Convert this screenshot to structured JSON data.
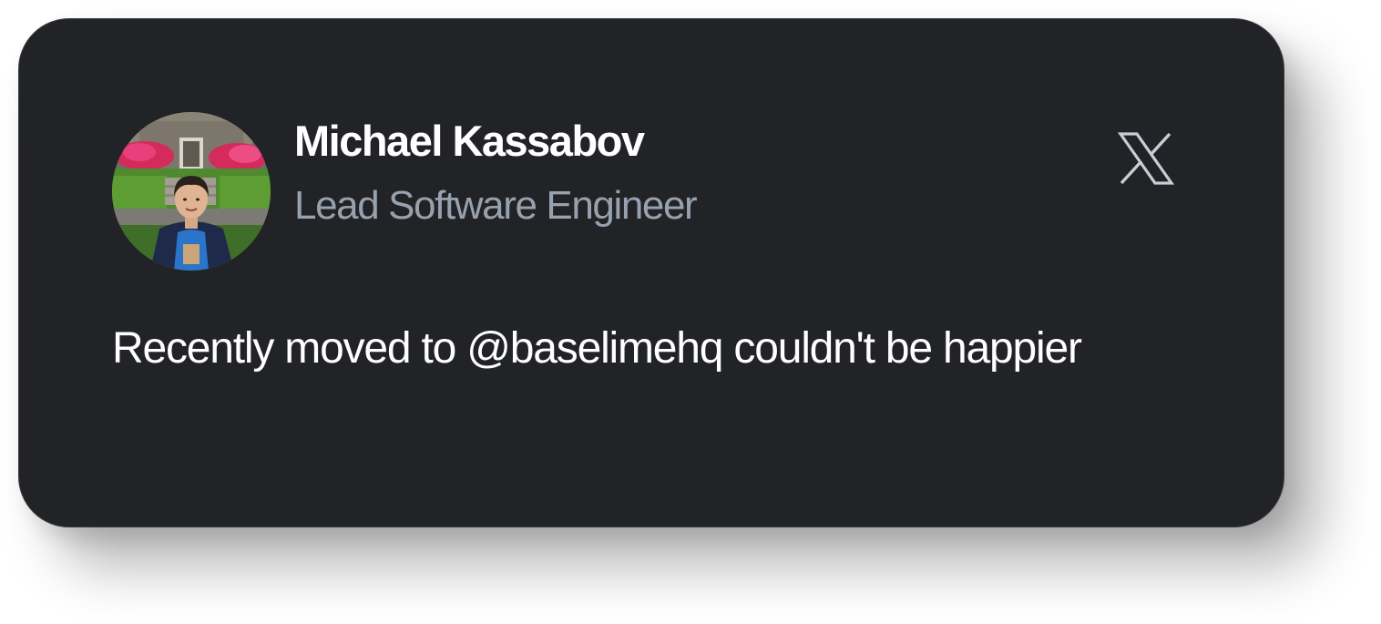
{
  "author": {
    "name": "Michael Kassabov",
    "role": "Lead Software Engineer",
    "avatar_icon": "profile-photo"
  },
  "tweet": {
    "text": "Recently moved to @baselimehq couldn't be happier"
  },
  "platform": {
    "icon": "x-logo-icon"
  },
  "colors": {
    "card_background": "#222327",
    "name_text": "#ffffff",
    "role_text": "#98a1ae",
    "body_text": "#ffffff",
    "icon_stroke": "#c9ced6"
  }
}
